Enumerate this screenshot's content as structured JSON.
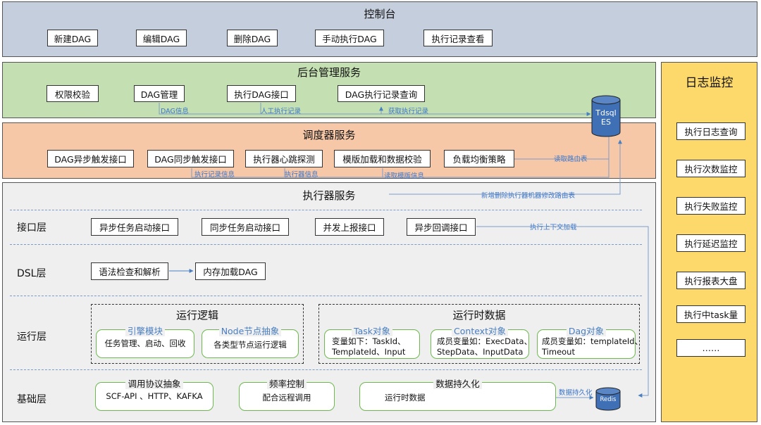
{
  "console": {
    "title": "控制台",
    "buttons": [
      "新建DAG",
      "编辑DAG",
      "删除DAG",
      "手动执行DAG",
      "执行记录查看"
    ]
  },
  "backend": {
    "title": "后台管理服务",
    "items": [
      "权限校验",
      "DAG管理",
      "执行DAG接口",
      "DAG执行记录查询"
    ],
    "edge_labels": [
      "DAG信息",
      "人工执行记录",
      "获取执行记录"
    ]
  },
  "scheduler": {
    "title": "调度器服务",
    "items": [
      "DAG异步触发接口",
      "DAG同步触发接口",
      "执行器心跳探测",
      "模版加载和数据校验",
      "负载均衡策略"
    ],
    "edge_labels": [
      "执行记录信息",
      "执行器信息",
      "读取模版信息",
      "读取路由表"
    ]
  },
  "executor": {
    "title": "执行器服务",
    "route_label": "新增删除执行器机器修改路由表",
    "layers": {
      "interface": {
        "name": "接口层",
        "items": [
          "异步任务启动接口",
          "同步任务启动接口",
          "并发上报接口",
          "异步回调接口"
        ],
        "edge_label": "执行上下文加载"
      },
      "dsl": {
        "name": "DSL层",
        "items": [
          "语法检查和解析",
          "内存加载DAG"
        ]
      },
      "runtime": {
        "name": "运行层",
        "logic": {
          "title": "运行逻辑",
          "modules": [
            {
              "title": "引擎模块",
              "body": "任务管理、启动、回收"
            },
            {
              "title": "Node节点抽象",
              "body": "各类型节点运行逻辑"
            }
          ]
        },
        "data": {
          "title": "运行时数据",
          "modules": [
            {
              "title": "Task对象",
              "line1": "变量如下：TaskId、",
              "line2": "TemplateId、Input"
            },
            {
              "title": "Context对象",
              "line1": "成员变量如：ExecData、",
              "line2": "StepData、InputData"
            },
            {
              "title": "Dag对象",
              "line1": "成员变量如：templateId、",
              "line2": "Timeout"
            }
          ]
        }
      },
      "base": {
        "name": "基础层",
        "modules": [
          {
            "title": "调用协议抽象",
            "body": "SCF-API 、HTTP、KAFKA"
          },
          {
            "title": "频率控制",
            "body": "配合远程调用"
          },
          {
            "title": "数据持久化",
            "body": "运行时数据"
          }
        ],
        "edge_label": "数据持久化"
      }
    }
  },
  "storage": {
    "tdsql_line1": "Tdsql",
    "tdsql_line2": "ES",
    "redis": "Redis"
  },
  "monitor": {
    "title": "日志监控",
    "items": [
      "执行日志查询",
      "执行次数监控",
      "执行失败监控",
      "执行延迟监控",
      "执行报表大盘",
      "执行中task量",
      "……"
    ]
  },
  "colors": {
    "console_bg": "#c5cedc",
    "backend_bg": "#c4e0b2",
    "scheduler_bg": "#f7c8a8",
    "executor_bg": "#efefef",
    "monitor_bg": "#fdd86a",
    "db_blue": "#3f6fb5",
    "edge_blue": "#4a7fc0",
    "module_border": "#6db84f"
  }
}
